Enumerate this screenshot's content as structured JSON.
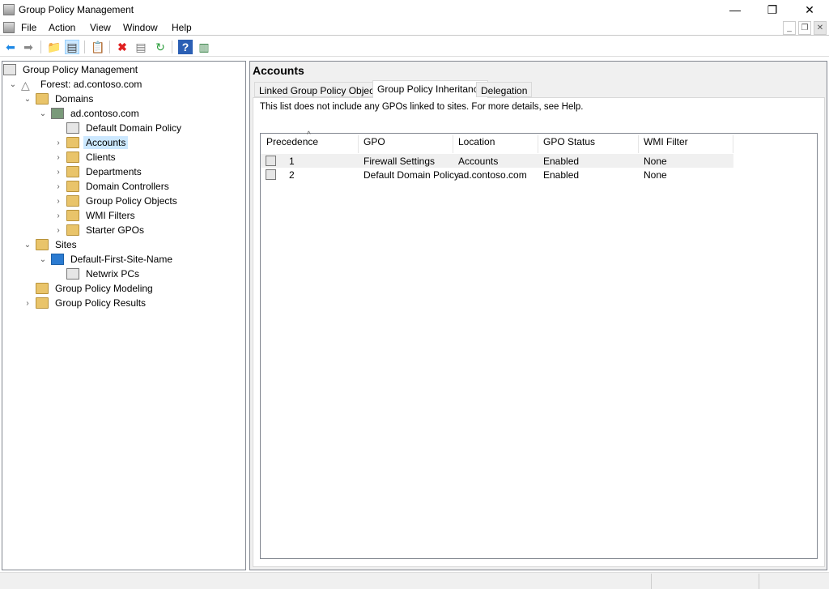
{
  "window": {
    "title": "Group Policy Management",
    "minimize": "—",
    "restore": "❐",
    "close": "✕"
  },
  "menu": [
    "File",
    "Action",
    "View",
    "Window",
    "Help"
  ],
  "toolbar": [
    "back-icon",
    "forward-icon",
    "up-folder-icon",
    "show-hide-console-tree-icon",
    "clipboard-icon",
    "delete-icon",
    "properties-icon",
    "refresh-icon",
    "help-icon",
    "action-pane-icon"
  ],
  "tree": [
    {
      "label": "Group Policy Management",
      "level": 0,
      "expander": "",
      "icon": "gpm"
    },
    {
      "label": "Forest: ad.contoso.com",
      "level": 1,
      "expander": "⌄",
      "icon": "forest"
    },
    {
      "label": "Domains",
      "level": 2,
      "expander": "⌄",
      "icon": "folder"
    },
    {
      "label": "ad.contoso.com",
      "level": 3,
      "expander": "⌄",
      "icon": "domain"
    },
    {
      "label": "Default Domain Policy",
      "level": 4,
      "expander": "",
      "icon": "gpo"
    },
    {
      "label": "Accounts",
      "level": 4,
      "expander": "›",
      "icon": "folder",
      "selected": true
    },
    {
      "label": "Clients",
      "level": 4,
      "expander": "›",
      "icon": "folder"
    },
    {
      "label": "Departments",
      "level": 4,
      "expander": "›",
      "icon": "folder"
    },
    {
      "label": "Domain Controllers",
      "level": 4,
      "expander": "›",
      "icon": "folder"
    },
    {
      "label": "Group Policy Objects",
      "level": 4,
      "expander": "›",
      "icon": "folder"
    },
    {
      "label": "WMI Filters",
      "level": 4,
      "expander": "›",
      "icon": "folder"
    },
    {
      "label": "Starter GPOs",
      "level": 4,
      "expander": "›",
      "icon": "folder"
    },
    {
      "label": "Sites",
      "level": 2,
      "expander": "⌄",
      "icon": "folder"
    },
    {
      "label": "Default-First-Site-Name",
      "level": 3,
      "expander": "⌄",
      "icon": "site"
    },
    {
      "label": "Netwrix PCs",
      "level": 4,
      "expander": "",
      "icon": "gpo"
    },
    {
      "label": "Group Policy Modeling",
      "level": 2,
      "expander": "",
      "icon": "folder"
    },
    {
      "label": "Group Policy Results",
      "level": 2,
      "expander": "›",
      "icon": "folder"
    }
  ],
  "content": {
    "title": "Accounts",
    "tabs": [
      "Linked Group Policy Objects",
      "Group Policy Inheritance",
      "Delegation"
    ],
    "active_tab": 1,
    "note": "This list does not include any GPOs linked to sites. For more details, see Help.",
    "columns": [
      "Precedence",
      "GPO",
      "Location",
      "GPO Status",
      "WMI Filter"
    ],
    "sort_indicator": "^",
    "rows": [
      {
        "precedence": "1",
        "gpo": "Firewall Settings",
        "location": "Accounts",
        "status": "Enabled",
        "wmi": "None"
      },
      {
        "precedence": "2",
        "gpo": "Default Domain Policy",
        "location": "ad.contoso.com",
        "status": "Enabled",
        "wmi": "None"
      }
    ]
  }
}
